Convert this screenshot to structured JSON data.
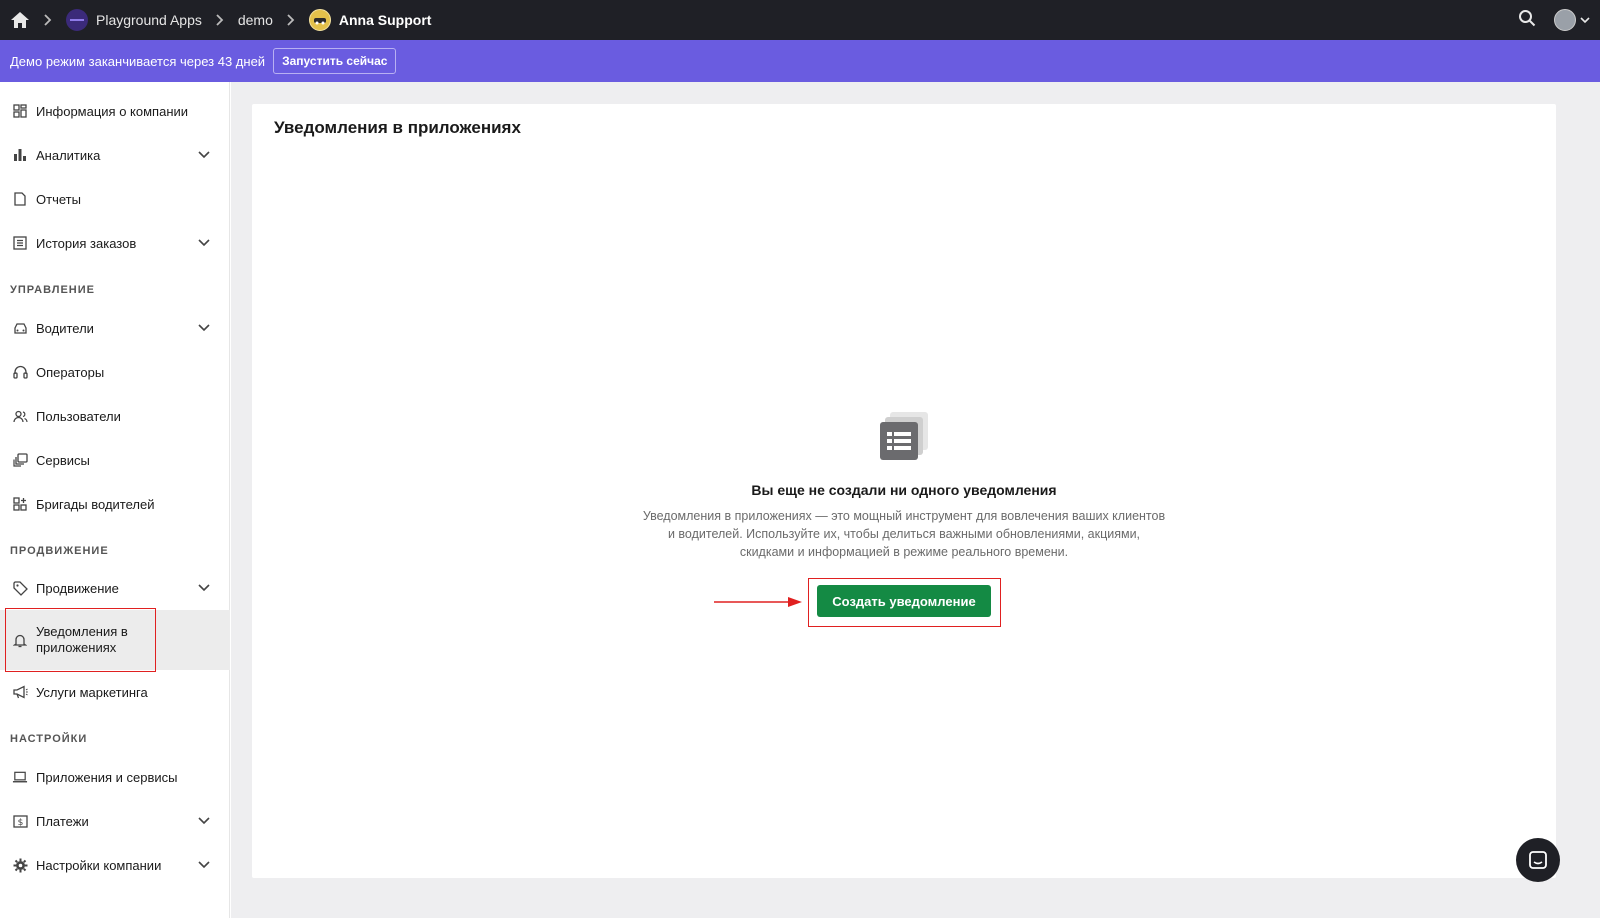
{
  "topbar": {
    "breadcrumbs": [
      {
        "label": "Playground Apps"
      },
      {
        "label": "demo"
      },
      {
        "label": "Anna Support"
      }
    ]
  },
  "banner": {
    "text": "Демо режим заканчивается через 43 дней",
    "button_label": "Запустить сейчас"
  },
  "sidebar": {
    "items": [
      {
        "label": "Информация о компании"
      },
      {
        "label": "Аналитика"
      },
      {
        "label": "Отчеты"
      },
      {
        "label": "История заказов"
      },
      {
        "label": "Водители"
      },
      {
        "label": "Операторы"
      },
      {
        "label": "Пользователи"
      },
      {
        "label": "Сервисы"
      },
      {
        "label": "Бригады водителей"
      },
      {
        "label": "Продвижение"
      },
      {
        "label": "Уведомления в приложениях"
      },
      {
        "label": "Услуги маркетинга"
      },
      {
        "label": "Приложения и сервисы"
      },
      {
        "label": "Платежи"
      },
      {
        "label": "Настройки компании"
      }
    ],
    "sections": {
      "management": "УПРАВЛЕНИЕ",
      "promotion": "ПРОДВИЖЕНИЕ",
      "settings": "НАСТРОЙКИ"
    }
  },
  "main": {
    "title": "Уведомления в приложениях",
    "empty_title": "Вы еще не создали ни одного уведомления",
    "empty_description": "Уведомления в приложениях — это мощный инструмент для вовлечения ваших клиентов и водителей. Используйте их, чтобы делиться важными обновлениями, акциями, скидками и информацией в режиме реального времени.",
    "create_button": "Создать уведомление"
  },
  "colors": {
    "topbar": "#1f2026",
    "banner": "#6a5ce0",
    "primary_button": "#148a44",
    "highlight": "#e02020"
  }
}
